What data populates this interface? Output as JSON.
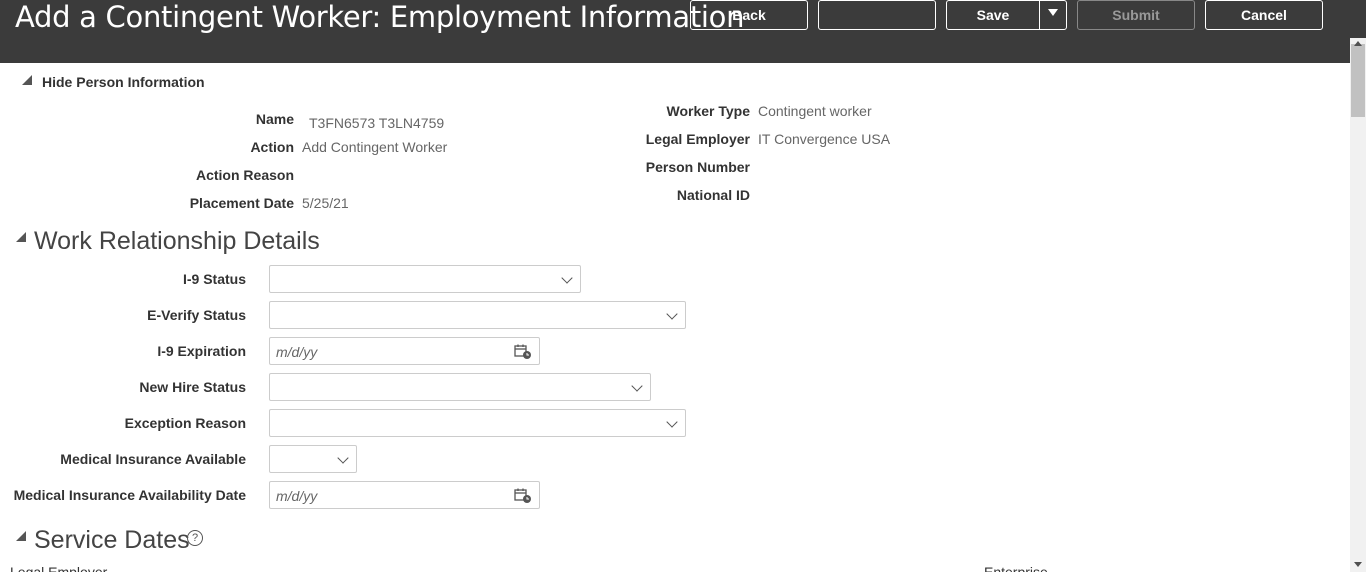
{
  "header": {
    "title": "Add a Contingent Worker: Employment Information",
    "back_label": "Back",
    "save_label": "Save",
    "submit_label": "Submit",
    "cancel_label": "Cancel"
  },
  "person_info": {
    "toggle_label": "Hide Person Information",
    "name_label": "Name",
    "name_value": "T3FN6573 T3LN4759",
    "action_label": "Action",
    "action_value": "Add Contingent Worker",
    "action_reason_label": "Action Reason",
    "placement_date_label": "Placement Date",
    "placement_date_value": "5/25/21",
    "worker_type_label": "Worker Type",
    "worker_type_value": "Contingent worker",
    "legal_employer_label": "Legal Employer",
    "legal_employer_value": "IT Convergence USA",
    "person_number_label": "Person Number",
    "national_id_label": "National ID"
  },
  "work_relationship": {
    "title": "Work Relationship Details",
    "i9_status_label": "I-9 Status",
    "everify_label": "E-Verify Status",
    "i9_expiration_label": "I-9 Expiration",
    "i9_expiration_placeholder": "m/d/yy",
    "new_hire_label": "New Hire Status",
    "exception_reason_label": "Exception Reason",
    "medical_ins_label": "Medical Insurance Available",
    "medical_ins_date_label": "Medical Insurance Availability Date",
    "medical_ins_date_placeholder": "m/d/yy"
  },
  "service_dates": {
    "title": "Service Dates",
    "help_glyph": "?",
    "col1_label": "Legal Employer",
    "col2_label": "Enterprise"
  }
}
